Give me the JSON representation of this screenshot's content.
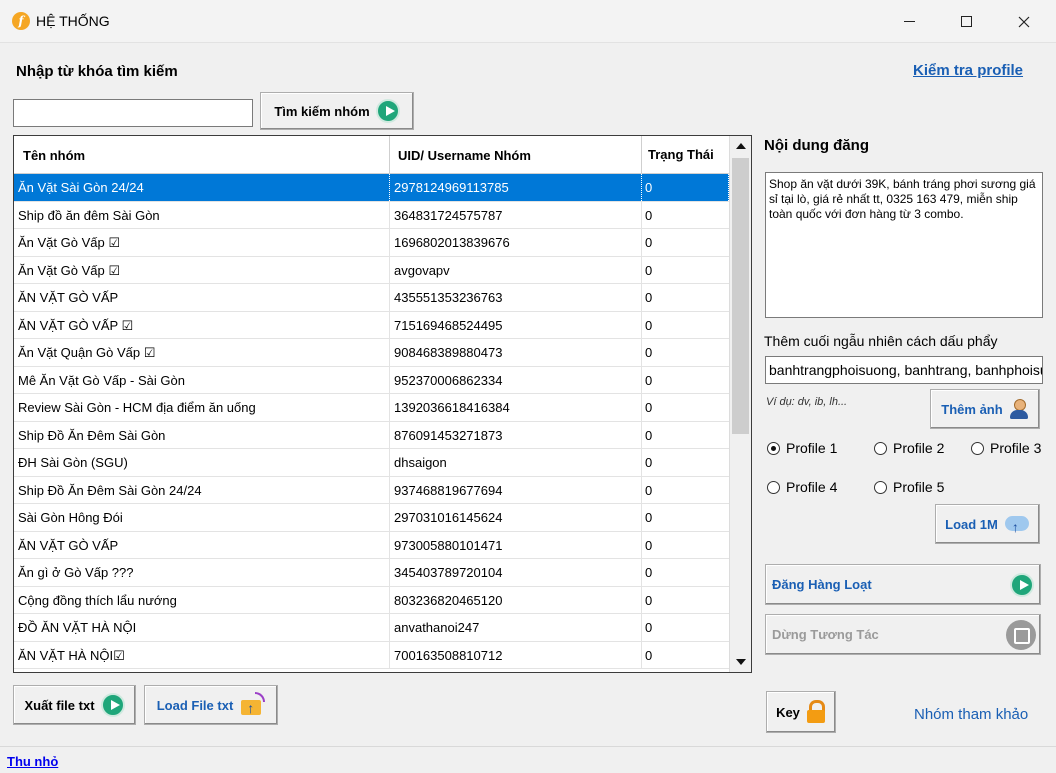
{
  "window": {
    "title": "HỆ THỐNG",
    "app_icon_letter": "f"
  },
  "search": {
    "label": "Nhập từ khóa tìm kiếm",
    "value": "",
    "button_label": "Tìm kiếm nhóm"
  },
  "check_profile_link": "Kiểm tra profile",
  "table": {
    "headers": [
      "Tên nhóm",
      "UID/ Username Nhóm",
      "Trạng Thái"
    ],
    "rows": [
      {
        "name": "Ăn Vặt Sài Gòn 24/24",
        "uid": "2978124969113785",
        "status": "0"
      },
      {
        "name": "Ship đồ ăn đêm Sài Gòn",
        "uid": "364831724575787",
        "status": "0"
      },
      {
        "name": "Ăn Vặt Gò Vấp ☑",
        "uid": "1696802013839676",
        "status": "0"
      },
      {
        "name": "Ăn Vặt Gò Vấp ☑",
        "uid": "avgovapv",
        "status": "0"
      },
      {
        "name": "ĂN VẶT GÒ VẤP",
        "uid": "435551353236763",
        "status": "0"
      },
      {
        "name": "ĂN VẶT GÒ VẤP ☑",
        "uid": "715169468524495",
        "status": "0"
      },
      {
        "name": "Ăn Vặt Quận Gò Vấp ☑",
        "uid": "908468389880473",
        "status": "0"
      },
      {
        "name": "Mê Ăn Vặt Gò Vấp - Sài Gòn",
        "uid": "952370006862334",
        "status": "0"
      },
      {
        "name": "Review Sài Gòn - HCM địa điểm ăn uống",
        "uid": "1392036618416384",
        "status": "0"
      },
      {
        "name": "Ship Đồ Ăn Đêm Sài Gòn",
        "uid": "876091453271873",
        "status": "0"
      },
      {
        "name": "ĐH Sài Gòn (SGU)",
        "uid": "dhsaigon",
        "status": "0"
      },
      {
        "name": "Ship Đồ Ăn Đêm Sài Gòn 24/24",
        "uid": "937468819677694",
        "status": "0"
      },
      {
        "name": "Sài Gòn Hông Đói",
        "uid": "297031016145624",
        "status": "0"
      },
      {
        "name": "ĂN VẶT GÒ VẤP",
        "uid": "973005880101471",
        "status": "0"
      },
      {
        "name": "Ăn gì ở Gò Vấp ???",
        "uid": "345403789720104",
        "status": "0"
      },
      {
        "name": "Cộng đồng thích lẩu nướng",
        "uid": "803236820465120",
        "status": "0"
      },
      {
        "name": "ĐỒ ĂN VẶT HÀ NỘI",
        "uid": "anvathanoi247",
        "status": "0"
      },
      {
        "name": "ĂN VẶT HÀ NỘI☑",
        "uid": "700163508810712",
        "status": "0"
      }
    ]
  },
  "post": {
    "label": "Nội dung đăng",
    "content": "Shop ăn vặt dưới 39K, bánh tráng phơi sương giá sỉ tại lò, giá rẻ nhất tt, 0325 163 479, miễn ship toàn quốc với đơn hàng từ 3 combo.",
    "suffix_label": "Thêm cuối ngẫu nhiên cách dấu phẩy",
    "suffix_value": "banhtrangphoisuong, banhtrang, banhphoisuong",
    "example": "Ví dụ: dv, ib, lh...",
    "add_image_button": "Thêm ảnh"
  },
  "profiles": {
    "options": [
      "Profile 1",
      "Profile 2",
      "Profile 3",
      "Profile 4",
      "Profile 5"
    ],
    "selected": "Profile 1"
  },
  "buttons": {
    "load_1m": "Load 1M",
    "post_bulk": "Đăng Hàng Loạt",
    "stop": "Dừng Tương Tác",
    "export_txt": "Xuất file txt",
    "load_txt": "Load File txt",
    "key": "Key"
  },
  "reference_groups_link": "Nhóm tham khảo",
  "minimize_link": "Thu nhỏ",
  "colors": {
    "selection": "#0078d7",
    "link": "#1a5fb4",
    "play_icon": "#1fa67a"
  }
}
